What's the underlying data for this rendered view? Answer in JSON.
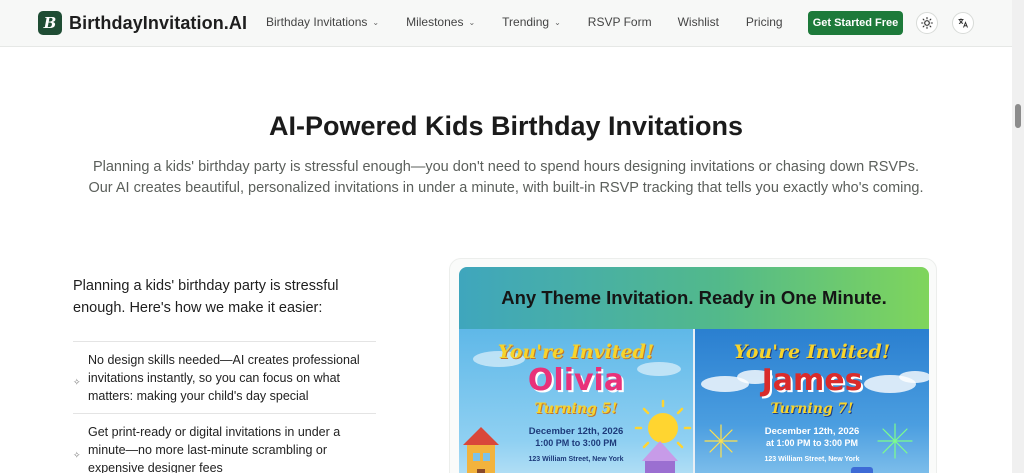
{
  "header": {
    "brand": "BirthdayInvitation.AI",
    "logo_letter": "B",
    "nav": [
      {
        "label": "Birthday Invitations",
        "has_dropdown": true
      },
      {
        "label": "Milestones",
        "has_dropdown": true
      },
      {
        "label": "Trending",
        "has_dropdown": true
      },
      {
        "label": "RSVP Form",
        "has_dropdown": false
      },
      {
        "label": "Wishlist",
        "has_dropdown": false
      },
      {
        "label": "Pricing",
        "has_dropdown": false
      }
    ],
    "cta_label": "Get Started Free",
    "theme_icon": "sun-icon",
    "language_icon": "translate-icon"
  },
  "hero": {
    "title": "AI-Powered Kids Birthday Invitations",
    "subtitle_line1": "Planning a kids' birthday party is stressful enough—you don't need to spend hours designing invitations or chasing down RSVPs.",
    "subtitle_line2": "Our AI creates beautiful, personalized invitations in under a minute, with built-in RSVP tracking that tells you exactly who's coming."
  },
  "features": {
    "intro": "Planning a kids' birthday party is stressful enough. Here's how we make it easier:",
    "items": [
      {
        "icon": "sparkle-icon",
        "text": "No design skills needed—AI creates professional invitations instantly, so you can focus on what matters: making your child's day special"
      },
      {
        "icon": "sparkle-icon",
        "text": "Get print-ready or digital invitations in under a minute—no more last-minute scrambling or expensive designer fees"
      }
    ]
  },
  "showcase": {
    "banner": "Any Theme Invitation. Ready in One Minute.",
    "invitations": [
      {
        "youre_invited": "You're Invited!",
        "name": "Olivia",
        "turning": "Turning 5!",
        "date": "December 12th, 2026",
        "time": "1:00 PM to 3:00 PM",
        "address": "123 William Street, New York",
        "colors": {
          "heading": "#f7d42c",
          "name": "#e8317a",
          "turning": "#f7d42c",
          "text": "#1d3a7a"
        }
      },
      {
        "youre_invited": "You're Invited!",
        "name": "James",
        "turning": "Turning 7!",
        "date": "December 12th, 2026",
        "time": "at 1:00 PM to 3:00 PM",
        "address": "123 William Street, New York",
        "colors": {
          "heading": "#f7d42c",
          "name": "#d92b2b",
          "turning": "#f7d42c",
          "text": "#ffffff"
        }
      }
    ]
  },
  "colors": {
    "brand_green": "#1d7a3a",
    "logo_bg": "#1f4d34"
  }
}
